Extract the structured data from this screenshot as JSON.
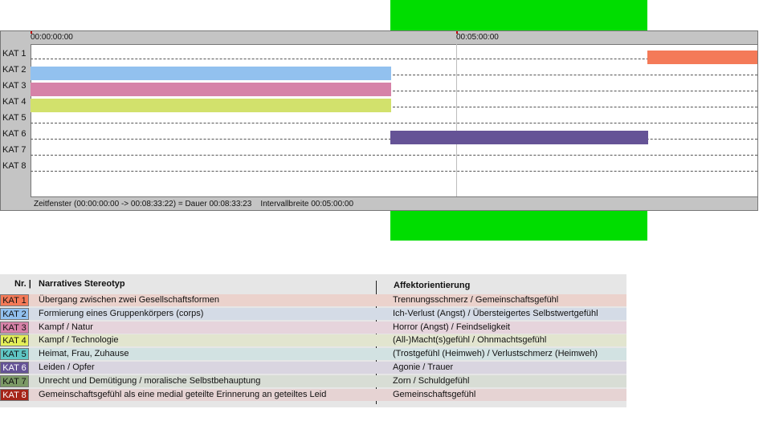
{
  "timeline": {
    "ticks": [
      "00:00:00:00",
      "00:05:00:00"
    ],
    "categories": [
      "KAT 1",
      "KAT 2",
      "KAT 3",
      "KAT 4",
      "KAT 5",
      "KAT 6",
      "KAT 7",
      "KAT 8"
    ],
    "status": "Zeitfenster (00:00:00:00 -> 00:08:33:22) = Dauer 00:08:33:23    Intervallbreite 00:05:00:00",
    "bar_colors": {
      "kat1": "#f47a58",
      "kat2": "#92c1ef",
      "kat3": "#d682a8",
      "kat4": "#d2e16c",
      "kat6": "#655396"
    }
  },
  "legend": {
    "header_nr": "Nr. |",
    "header_stereotyp": "Narratives Stereotyp",
    "header_affekt": "Affektorientierung",
    "rows": [
      {
        "kat": "KAT 1",
        "stereotyp": "Übergang zwischen zwei Gesellschaftsformen",
        "affekt": "Trennungsschmerz / Gemeinschaftsgefühl",
        "color": "#f47a58",
        "row_color": "#ebd2cc"
      },
      {
        "kat": "KAT 2",
        "stereotyp": "Formierung eines Gruppenkörpers (corps)",
        "affekt": "Ich-Verlust (Angst) / Übersteigertes Selbstwertgefühl",
        "color": "#92c1ef",
        "row_color": "#d4dbe6"
      },
      {
        "kat": "KAT 3",
        "stereotyp": "Kampf / Natur",
        "affekt": "Horror (Angst) / Feindseligkeit",
        "color": "#d682a8",
        "row_color": "#e6d4dc"
      },
      {
        "kat": "KAT 4",
        "stereotyp": "Kampf / Technologie",
        "affekt": "(All-)Macht(s)gefühl / Ohnmachtsgefühl",
        "color": "#e4ef5a",
        "row_color": "#e2e5cf"
      },
      {
        "kat": "KAT 5",
        "stereotyp": "Heimat, Frau, Zuhause",
        "affekt": "(Trostgefühl (Heimweh) / Verlustschmerz (Heimweh)",
        "color": "#5fc7c5",
        "row_color": "#d2e2e2"
      },
      {
        "kat": "KAT 6",
        "stereotyp": "Leiden / Opfer",
        "affekt": "Agonie / Trauer",
        "color": "#655396",
        "row_color": "#d9d5e0"
      },
      {
        "kat": "KAT 7",
        "stereotyp": "Unrecht und Demütigung / moralische Selbstbehauptung",
        "affekt": "Zorn / Schuldgefühl",
        "color": "#7c9a66",
        "row_color": "#d8ddd5"
      },
      {
        "kat": "KAT 8",
        "stereotyp": "Gemeinschaftsgefühl als eine medial geteilte Erinnerung an geteiltes Leid",
        "affekt": "Gemeinschaftsgefühl",
        "color": "#a52418",
        "row_color": "#e6d3d3"
      }
    ]
  }
}
